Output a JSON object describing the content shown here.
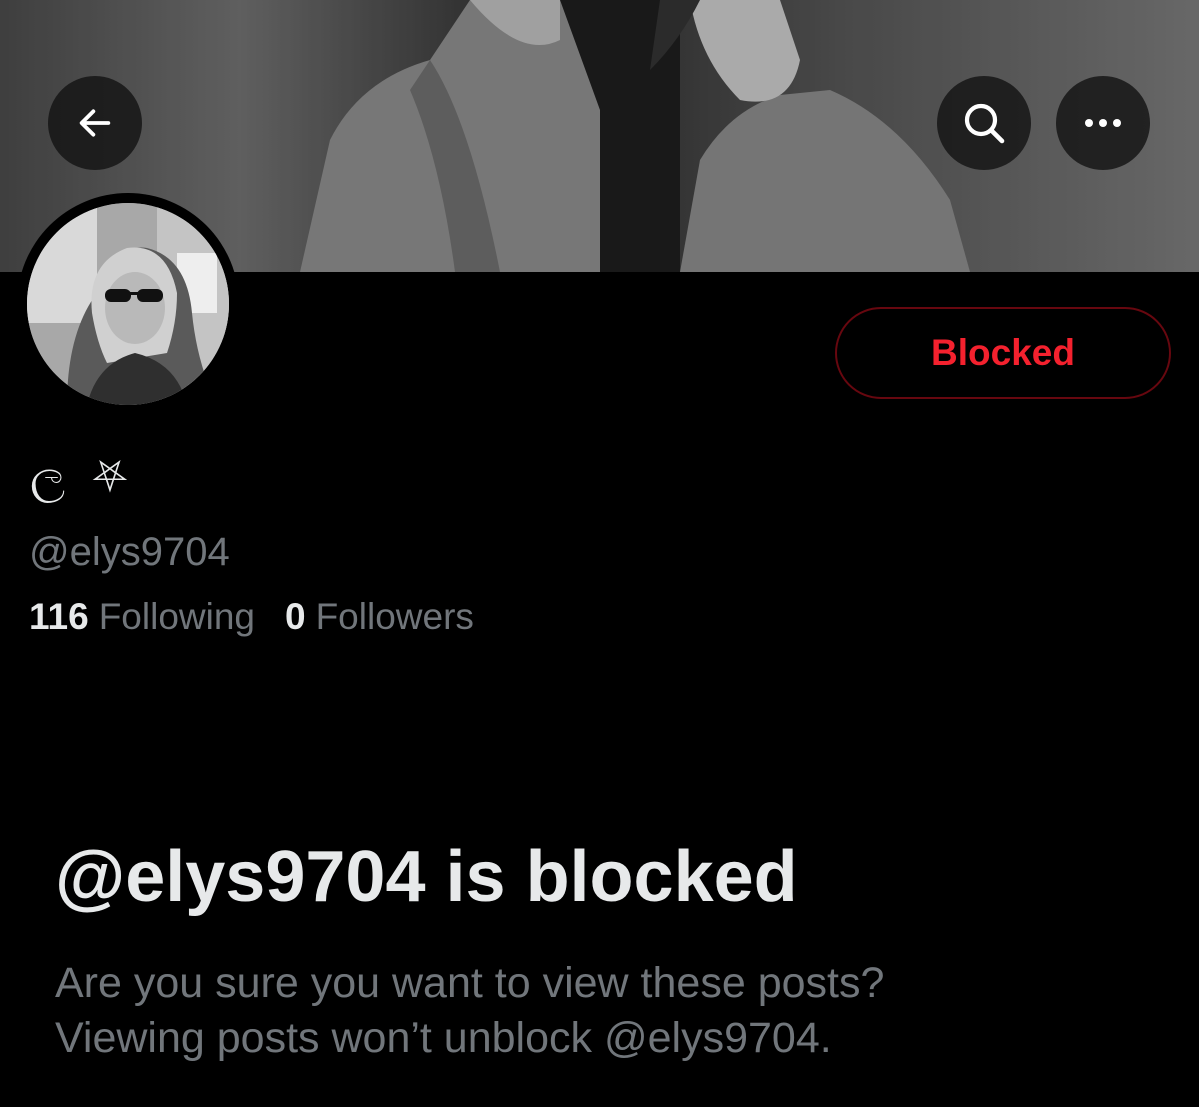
{
  "header": {
    "back_icon": "arrow-left-icon",
    "search_icon": "search-icon",
    "more_icon": "more-horizontal-icon"
  },
  "profile": {
    "display_name": "ල ⛧",
    "handle": "@elys9704",
    "block_button_label": "Blocked",
    "stats": {
      "following_count": "116",
      "following_label": "Following",
      "followers_count": "0",
      "followers_label": "Followers"
    }
  },
  "blocked_notice": {
    "title": "@elys9704 is blocked",
    "line1": "Are you sure you want to view these posts?",
    "line2": "Viewing posts won’t unblock @elys9704."
  },
  "colors": {
    "background": "#000000",
    "primary_text": "#e7e9ea",
    "secondary_text": "#71767b",
    "blocked_red": "#f4212e",
    "blocked_border": "#67070f"
  }
}
